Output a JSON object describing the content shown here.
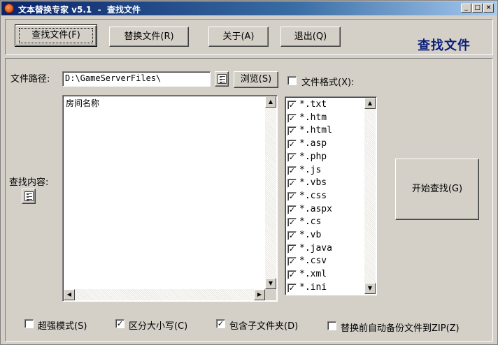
{
  "window": {
    "title": "文本替换专家 v5.1  -  查找文件",
    "controls": {
      "minimize": "_",
      "maximize": "□",
      "close": "×"
    }
  },
  "toolbar": {
    "find_files": "查找文件(F)",
    "replace_files": "替换文件(R)",
    "about": "关于(A)",
    "exit": "退出(Q)",
    "section_title": "查找文件"
  },
  "path": {
    "label": "文件路径:",
    "value": "D:\\GameServerFiles\\",
    "browse": "浏览(S)"
  },
  "content": {
    "label": "查找内容:",
    "value": "房间名称"
  },
  "formats": {
    "label": "文件格式(X):",
    "checked": false,
    "items": [
      {
        "name": "*.txt",
        "checked": true
      },
      {
        "name": "*.htm",
        "checked": true
      },
      {
        "name": "*.html",
        "checked": true
      },
      {
        "name": "*.asp",
        "checked": true
      },
      {
        "name": "*.php",
        "checked": true
      },
      {
        "name": "*.js",
        "checked": true
      },
      {
        "name": "*.vbs",
        "checked": true
      },
      {
        "name": "*.css",
        "checked": true
      },
      {
        "name": "*.aspx",
        "checked": true
      },
      {
        "name": "*.cs",
        "checked": true
      },
      {
        "name": "*.vb",
        "checked": true
      },
      {
        "name": "*.java",
        "checked": true
      },
      {
        "name": "*.csv",
        "checked": true
      },
      {
        "name": "*.xml",
        "checked": true
      },
      {
        "name": "*.ini",
        "checked": true
      }
    ]
  },
  "start_search": "开始查找(G)",
  "options": {
    "super_mode": {
      "label": "超强模式(S)",
      "checked": false
    },
    "case_sensitive": {
      "label": "区分大小写(C)",
      "checked": true
    },
    "include_subfolders": {
      "label": "包含子文件夹(D)",
      "checked": true
    },
    "backup_zip": {
      "label": "替换前自动备份文件到ZIP(Z)",
      "checked": false
    }
  },
  "icons": [
    "app-icon",
    "list-icon",
    "checkbox-icon",
    "scroll-up-icon",
    "scroll-down-icon",
    "scroll-left-icon",
    "scroll-right-icon"
  ]
}
